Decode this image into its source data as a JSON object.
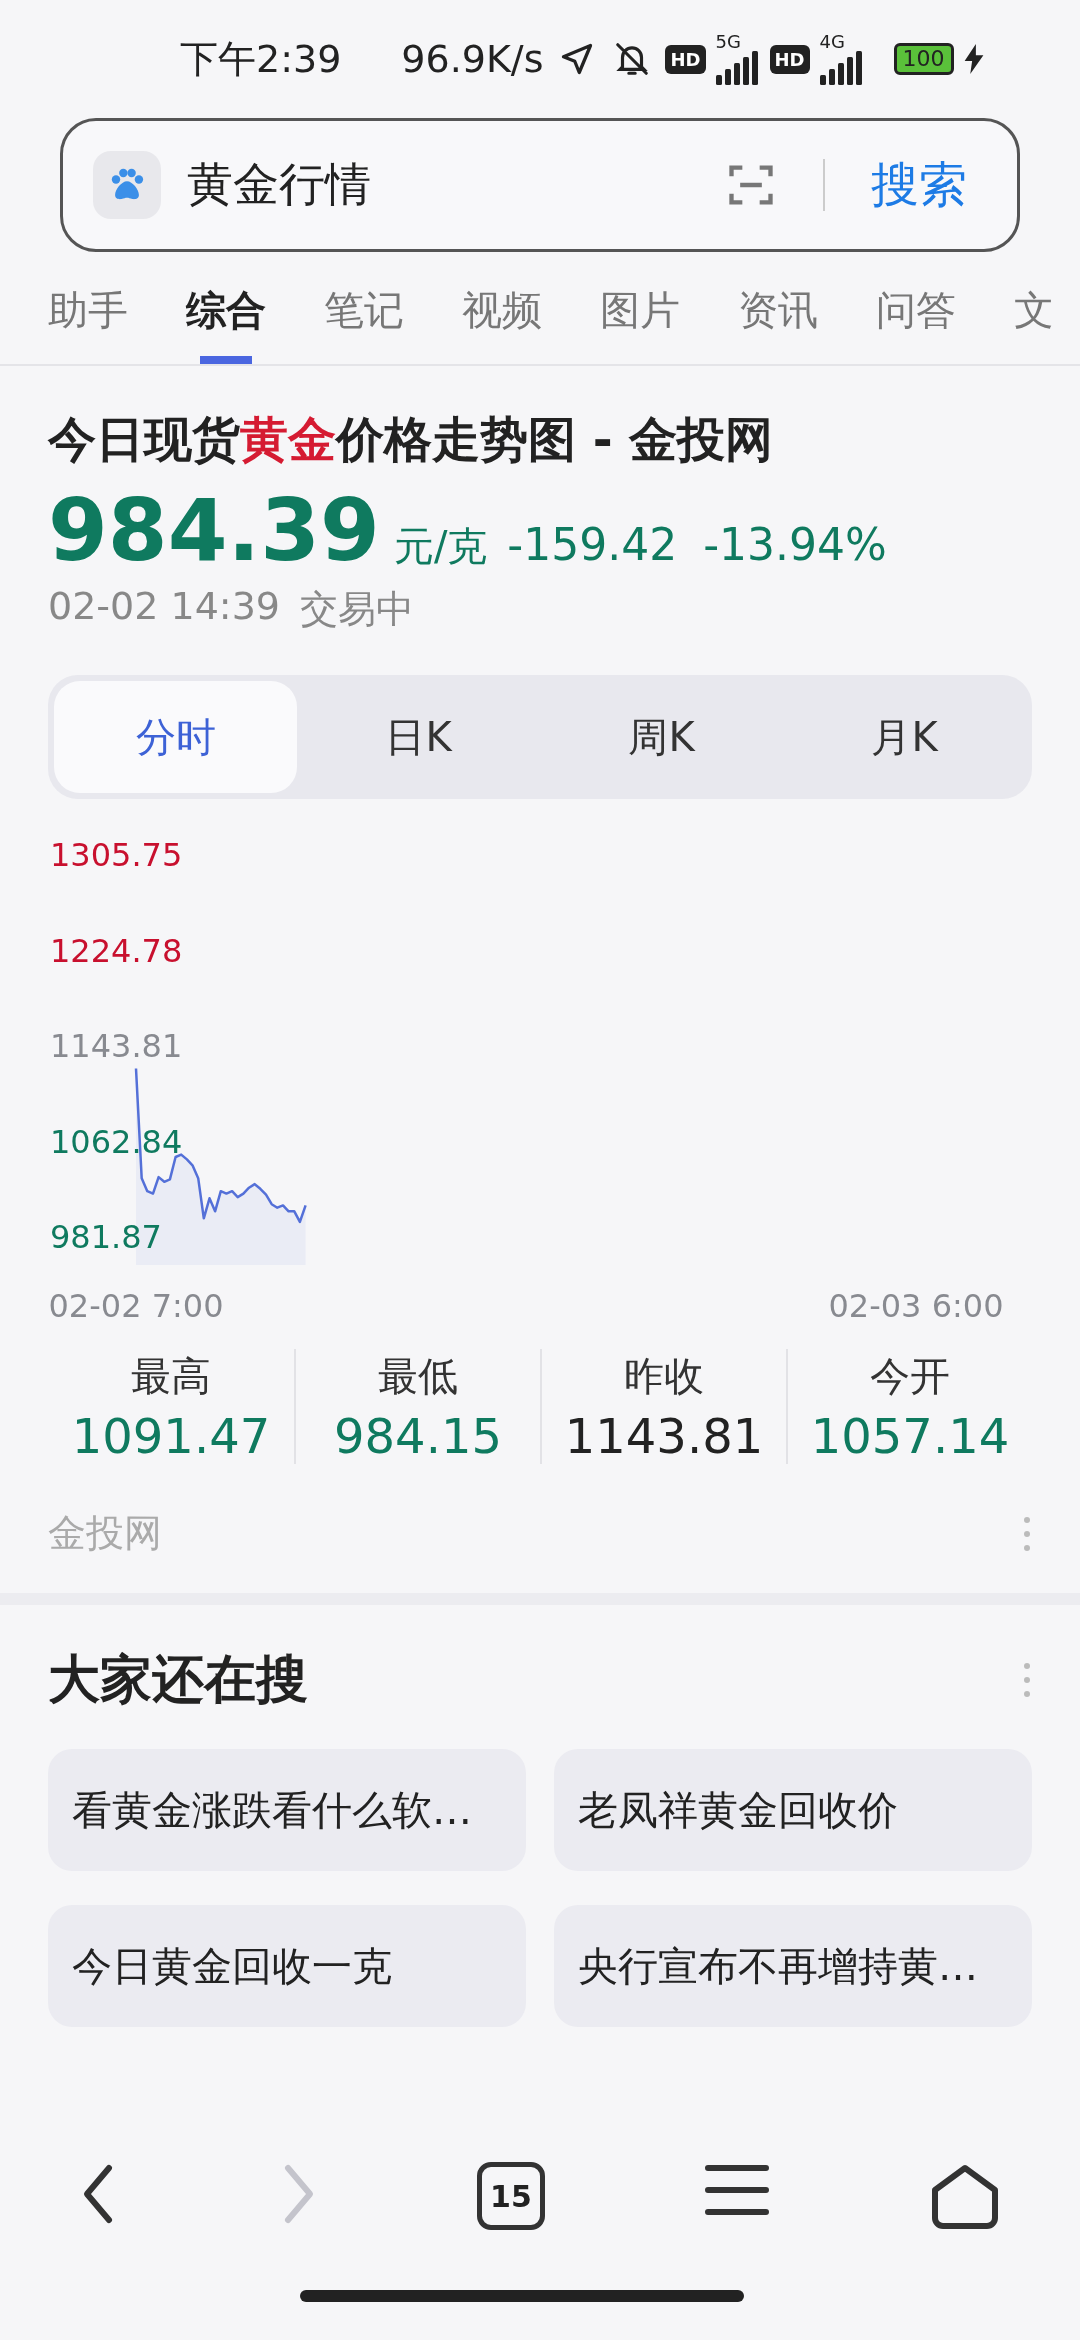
{
  "status_bar": {
    "time": "下午2:39",
    "net_speed": "96.9K/s",
    "sims": [
      {
        "badge": "HD",
        "network": "5G"
      },
      {
        "badge": "HD",
        "network": "4G"
      }
    ],
    "battery": "100"
  },
  "search": {
    "value": "黄金行情",
    "button": "搜索"
  },
  "tabs": [
    {
      "label": "助手",
      "selected": false
    },
    {
      "label": "综合",
      "selected": true
    },
    {
      "label": "笔记",
      "selected": false
    },
    {
      "label": "视频",
      "selected": false
    },
    {
      "label": "图片",
      "selected": false
    },
    {
      "label": "资讯",
      "selected": false
    },
    {
      "label": "问答",
      "selected": false
    },
    {
      "label": "文",
      "selected": false
    }
  ],
  "result": {
    "title": {
      "before": "今日现货",
      "highlight": "黄金",
      "after": "价格走势图 - 金投网"
    },
    "price": "984.39",
    "unit": "元/克",
    "change": "-159.42",
    "change_pct": "-13.94%",
    "time": "02-02 14:39",
    "status": "交易中",
    "periods": [
      {
        "label": "分时",
        "selected": true
      },
      {
        "label": "日K",
        "selected": false
      },
      {
        "label": "周K",
        "selected": false
      },
      {
        "label": "月K",
        "selected": false
      }
    ],
    "chart_data": {
      "type": "area",
      "ylim": [
        981.87,
        1305.75
      ],
      "yticks": [
        1305.75,
        1224.78,
        1143.81,
        1062.84,
        981.87
      ],
      "categories": [
        "02-02 7:00",
        null,
        null,
        null,
        null,
        null,
        null,
        null,
        null,
        null,
        null,
        null,
        null,
        null,
        null,
        null,
        null,
        null,
        null,
        null,
        null,
        null,
        null,
        null,
        null,
        null,
        null,
        null,
        null,
        null,
        null,
        null,
        null,
        null,
        null,
        null,
        null,
        null,
        null,
        null,
        null,
        null,
        null,
        null,
        null,
        null,
        null,
        null,
        null,
        null,
        null,
        null,
        null,
        null,
        null,
        null,
        null,
        null,
        null,
        null,
        null,
        null,
        null,
        null,
        null,
        null,
        null,
        null,
        null,
        null,
        null,
        null,
        null,
        null,
        null,
        null,
        null,
        null,
        null,
        null,
        null,
        null,
        null,
        null,
        null,
        null,
        null,
        null,
        null,
        null,
        null,
        null,
        null,
        null,
        null,
        null,
        null,
        null,
        null,
        null,
        null,
        null,
        null,
        null,
        null,
        null,
        null,
        null,
        null,
        null,
        null,
        null,
        null,
        null,
        null,
        null,
        null,
        null,
        null,
        null,
        null,
        null,
        null,
        null,
        null,
        null,
        null,
        null,
        null,
        null,
        null,
        null,
        null,
        null,
        null,
        null,
        null,
        null,
        "02-03 6:00"
      ],
      "series": [
        {
          "color": "#5470d8",
          "values": [
            1123,
            1030,
            1019,
            1017,
            1031,
            1027,
            1029,
            1048,
            1050,
            1046,
            1041,
            1030,
            996,
            1013,
            1002,
            1019,
            1017,
            1019,
            1014,
            1017,
            1022,
            1025,
            1021,
            1016,
            1008,
            1005,
            1007,
            1002,
            1002,
            993,
            1007,
            null,
            null,
            null,
            null,
            null,
            null,
            null,
            null,
            null,
            null,
            null,
            null,
            null,
            null,
            null,
            null,
            null,
            null,
            null,
            null,
            null,
            null,
            null,
            null,
            null,
            null,
            null,
            null,
            null,
            null,
            null,
            null,
            null,
            null,
            null,
            null,
            null,
            null,
            null,
            null,
            null,
            null,
            null,
            null,
            null,
            null,
            null,
            null,
            null,
            null,
            null,
            null,
            null,
            null,
            null,
            null,
            null,
            null,
            null,
            null,
            null,
            null,
            null,
            null,
            null,
            null,
            null,
            null,
            null,
            null,
            null,
            null,
            null,
            null,
            null,
            null,
            null,
            null,
            null,
            null,
            null,
            null,
            null,
            null,
            null,
            null,
            null,
            null,
            null,
            null,
            null,
            null,
            null,
            null,
            null,
            null,
            null,
            null,
            null,
            null,
            null,
            null,
            null,
            null,
            null,
            null,
            null,
            null
          ]
        }
      ]
    },
    "stats": [
      {
        "label": "最高",
        "value": "1091.47",
        "color": "#0f7a5f"
      },
      {
        "label": "最低",
        "value": "984.15",
        "color": "#0f7a5f"
      },
      {
        "label": "昨收",
        "value": "1143.81",
        "color": "#222222"
      },
      {
        "label": "今开",
        "value": "1057.14",
        "color": "#0f7a5f"
      }
    ],
    "source": "金投网"
  },
  "related": {
    "title": "大家还在搜",
    "items": [
      "看黄金涨跌看什么软…",
      "老凤祥黄金回收价",
      "今日黄金回收一克",
      "央行宣布不再增持黄…"
    ]
  },
  "bottom_nav": {
    "tab_count": "15",
    "forward_disabled": true
  }
}
